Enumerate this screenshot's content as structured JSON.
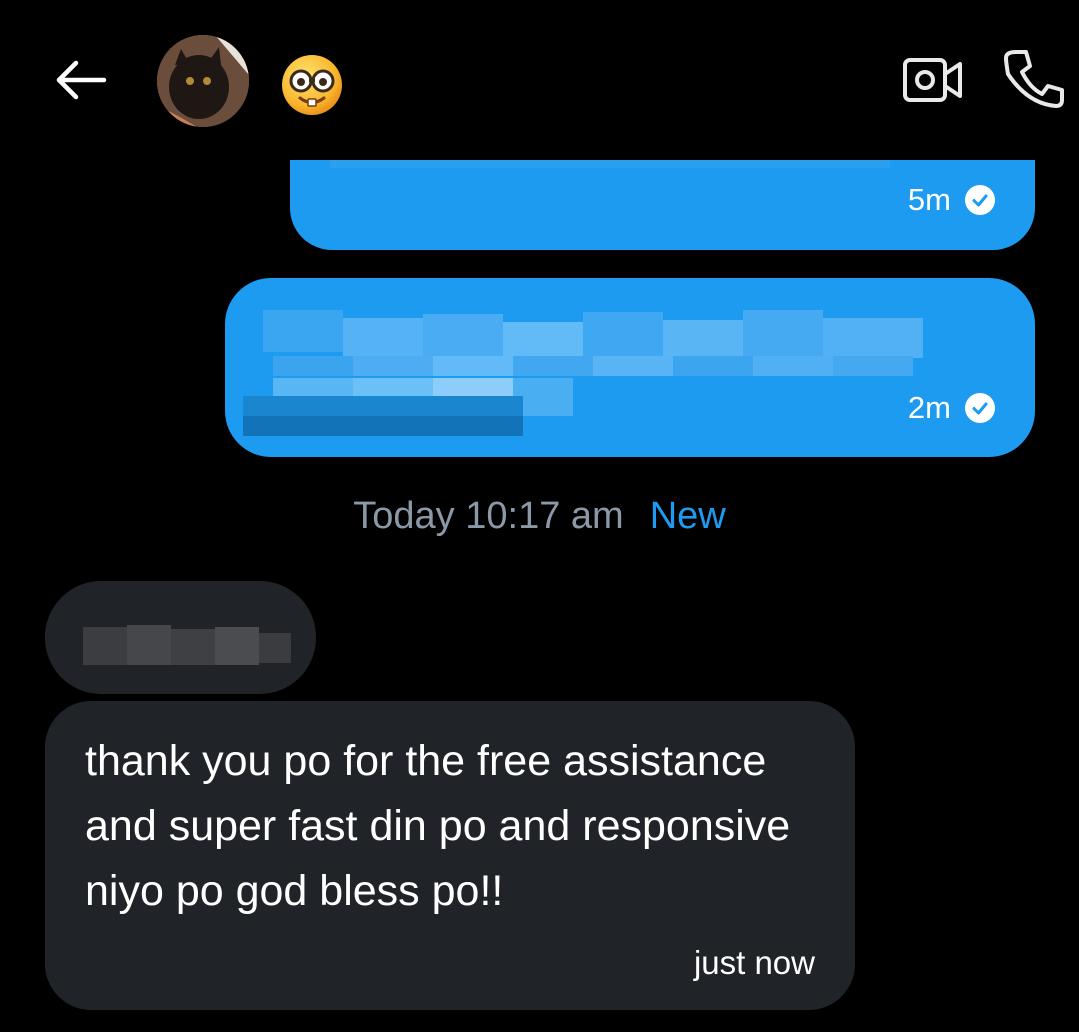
{
  "header": {
    "back_icon": "arrow-left-icon",
    "avatar_alt": "cat avatar",
    "emoji_icon": "nerd-face-emoji-icon",
    "video_icon": "video-call-icon",
    "phone_icon": "phone-call-icon"
  },
  "messages": [
    {
      "direction": "outgoing",
      "text_redacted": true,
      "time": "5m",
      "status_icon": "check-circle-icon"
    },
    {
      "direction": "outgoing",
      "text_redacted": true,
      "time": "2m",
      "status_icon": "check-circle-icon"
    },
    {
      "direction": "incoming",
      "text_redacted": true
    },
    {
      "direction": "incoming",
      "text": "thank you po for the free assistance and super fast din po and responsive niyo po god bless po!!",
      "time": "just now"
    }
  ],
  "separator": {
    "time": "Today 10:17 am",
    "new_label": "New"
  },
  "colors": {
    "background": "#000000",
    "outgoing_bubble": "#1d9bf0",
    "incoming_bubble": "#202327",
    "accent": "#1d9bf0",
    "muted_text": "#8b98a5"
  }
}
